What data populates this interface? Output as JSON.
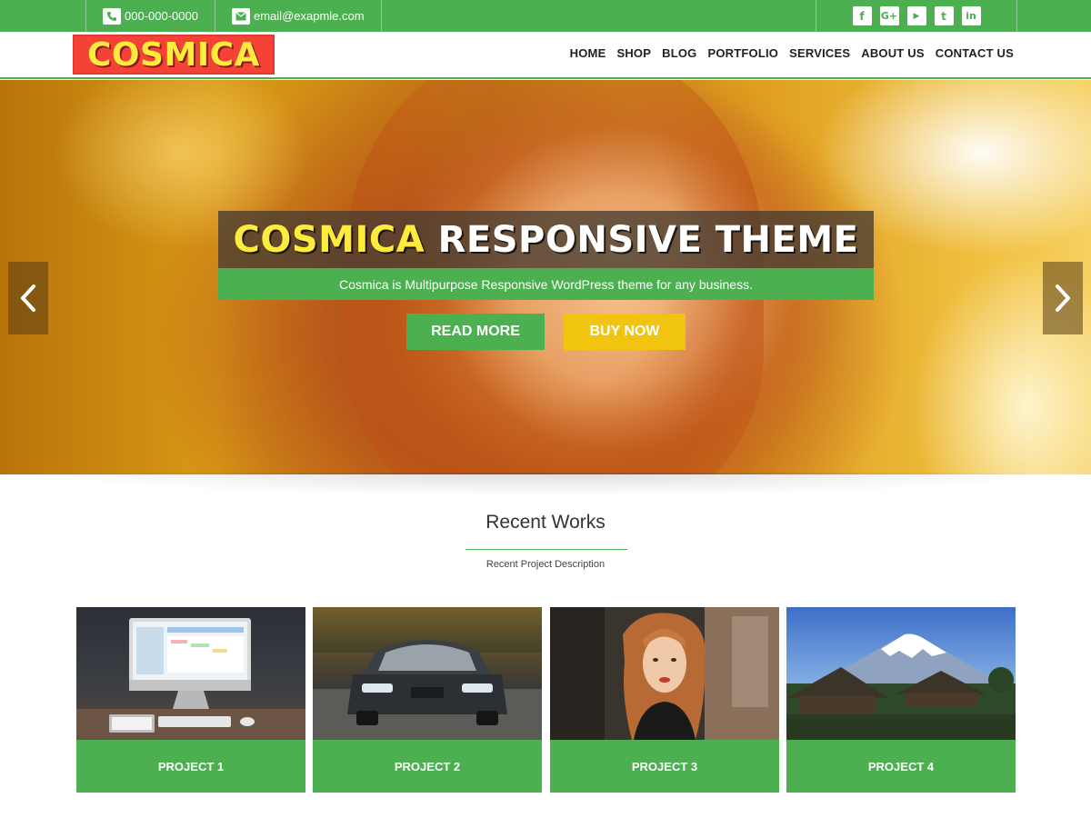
{
  "topbar": {
    "phone": "000-000-0000",
    "email": "email@exapmle.com",
    "socials": [
      {
        "icon": "facebook-icon",
        "glyph": "f"
      },
      {
        "icon": "google-plus-icon",
        "glyph": "G+"
      },
      {
        "icon": "youtube-icon",
        "glyph": "▶"
      },
      {
        "icon": "twitter-icon",
        "glyph": "t"
      },
      {
        "icon": "linkedin-icon",
        "glyph": "in"
      }
    ]
  },
  "header": {
    "logo": "COSMICA",
    "nav": [
      "HOME",
      "SHOP",
      "BLOG",
      "PORTFOLIO",
      "SERVICES",
      "ABOUT US",
      "CONTACT US"
    ]
  },
  "hero": {
    "title_accent": "COSMICA",
    "title_rest": " RESPONSIVE THEME",
    "subtitle": "Cosmica is Multipurpose Responsive WordPress theme for any business.",
    "read_more": "READ MORE",
    "buy_now": "BUY NOW"
  },
  "recent": {
    "title": "Recent Works",
    "description": "Recent Project Description",
    "projects": [
      {
        "label": "PROJECT 1",
        "image": "computer-desk-image"
      },
      {
        "label": "PROJECT 2",
        "image": "car-image"
      },
      {
        "label": "PROJECT 3",
        "image": "woman-portrait-image"
      },
      {
        "label": "PROJECT 4",
        "image": "mountain-village-image"
      }
    ]
  },
  "colors": {
    "primary": "#4caf50",
    "accent_yellow": "#f1c40f",
    "logo_bg": "#f44336",
    "logo_text": "#ffeb3b"
  }
}
